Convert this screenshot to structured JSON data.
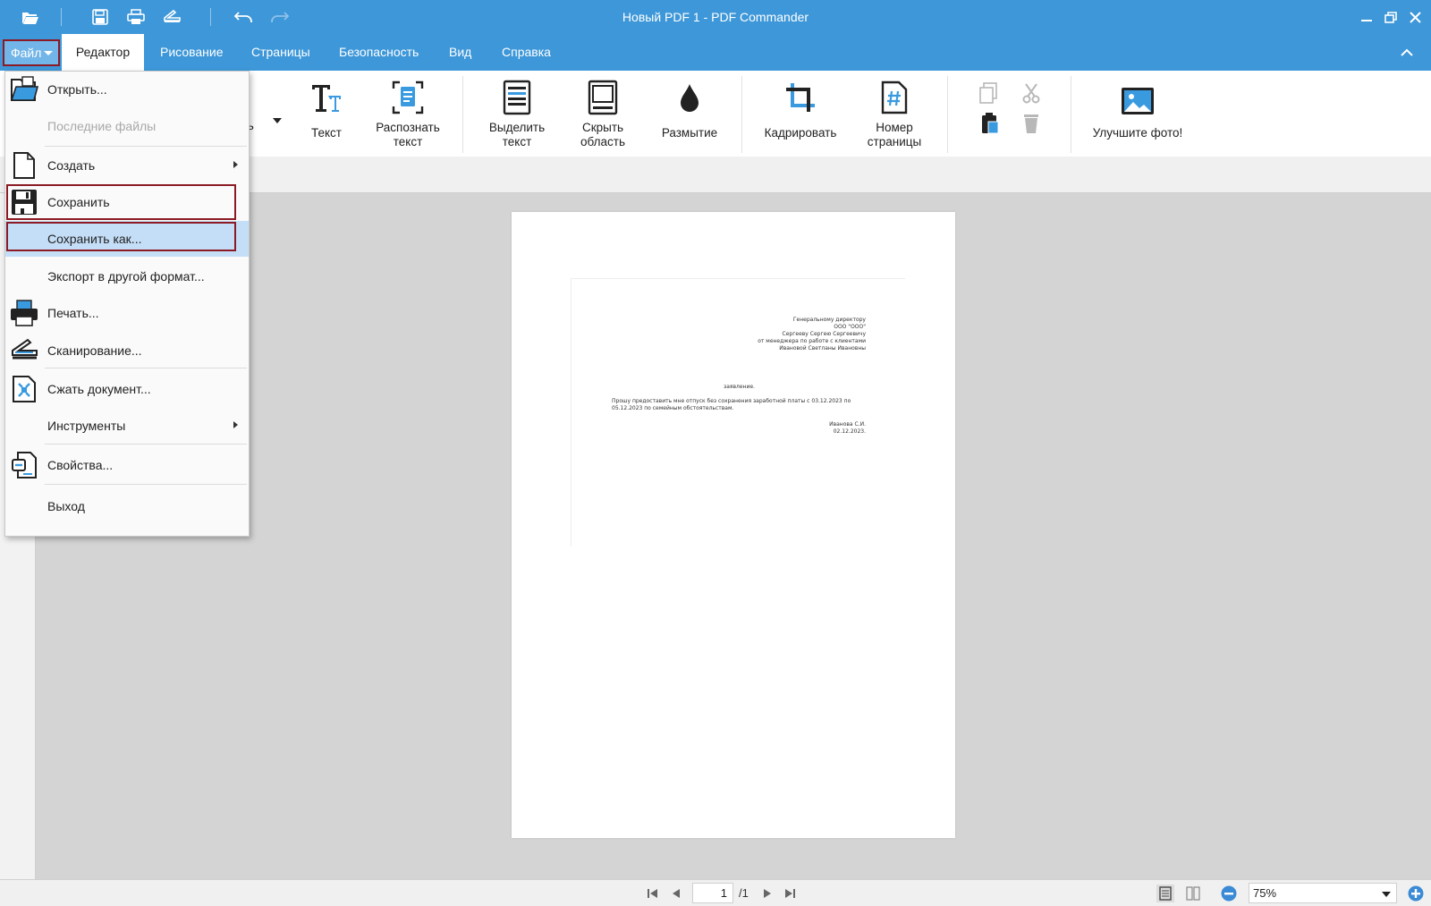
{
  "window": {
    "title": "Новый PDF 1 - PDF Commander"
  },
  "menu": {
    "file": "Файл",
    "tabs": [
      {
        "label": "Редактор"
      },
      {
        "label": "Рисование"
      },
      {
        "label": "Страницы"
      },
      {
        "label": "Безопасность"
      },
      {
        "label": "Вид"
      },
      {
        "label": "Справка"
      }
    ]
  },
  "ribbon": {
    "partial_label": "сь",
    "text": "Текст",
    "recognize": [
      "Распознать",
      "текст"
    ],
    "highlight": [
      "Выделить",
      "текст"
    ],
    "hide": [
      "Скрыть",
      "область"
    ],
    "blur": "Размытие",
    "crop": "Кадрировать",
    "page_number": [
      "Номер",
      "страницы"
    ],
    "enhance": "Улучшите фото!"
  },
  "file_menu": {
    "open": "Открыть...",
    "recent": "Последние файлы",
    "create": "Создать",
    "save": "Сохранить",
    "save_as": "Сохранить как...",
    "export": "Экспорт в другой формат...",
    "print": "Печать...",
    "scan": "Сканирование...",
    "compress": "Сжать документ...",
    "tools": "Инструменты",
    "properties": "Свойства...",
    "exit": "Выход"
  },
  "document": {
    "addressee": [
      "Генеральному директору",
      "ООО \"ООО\"",
      "Сергееву Сергею Сергеевичу",
      "от менеджера по работе с клиентами",
      "Ивановой Светланы Ивановны"
    ],
    "heading": "заявление.",
    "body": [
      "Прошу предоставить мне отпуск без сохранения заработной платы с 03.12.2023 по",
      "05.12.2023 по семейным обстоятельствам."
    ],
    "signature": [
      "Иванова С.И.",
      "02.12.2023."
    ]
  },
  "status": {
    "page_current": "1",
    "page_total": "/1",
    "zoom": "75%"
  },
  "colors": {
    "titlebar": "#3d97d8",
    "highlight_outline": "#8b1a24",
    "menu_highlight": "#c4def7"
  }
}
